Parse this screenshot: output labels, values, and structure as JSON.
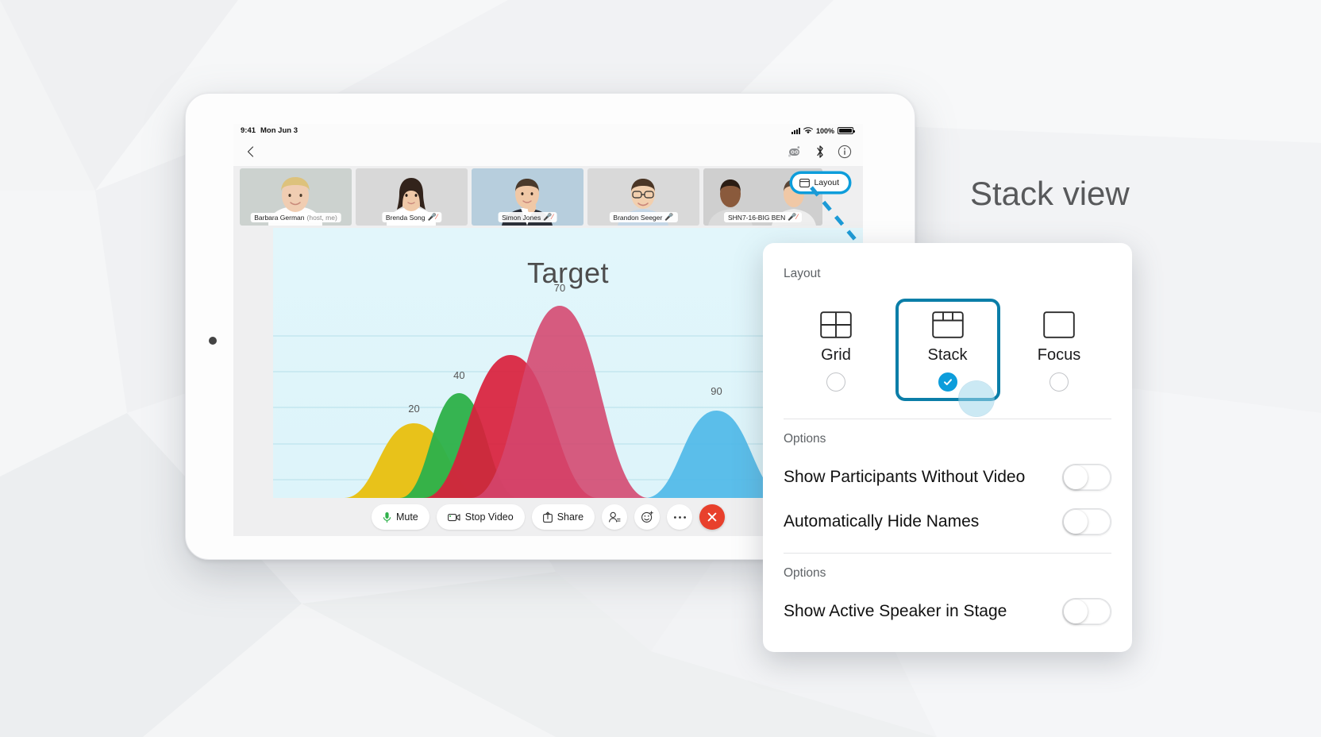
{
  "caption": "Stack view",
  "tablet": {
    "status_bar": {
      "time": "9:41",
      "date": "Mon Jun 3",
      "battery": "100%"
    },
    "nav": {
      "back_icon": "chevron-left-icon",
      "icons": [
        "bot-icon",
        "bluetooth-icon",
        "info-icon"
      ]
    },
    "layout_button": {
      "label": "Layout",
      "icon": "layout-icon"
    },
    "participants": [
      {
        "name": "Barbara German",
        "suffix": "(host, me)",
        "mic": "none",
        "skin": "#f0cdb2",
        "hair": "#d9c07a",
        "shirt": "#ffffff",
        "bg": "#ccd2cf"
      },
      {
        "name": "Brenda Song",
        "suffix": "",
        "mic": "muted",
        "skin": "#efc9a8",
        "hair": "#3b2a21",
        "shirt": "#ffffff",
        "bg": "#d8d8d8"
      },
      {
        "name": "Simon Jones",
        "suffix": "",
        "mic": "muted",
        "skin": "#f0c8a6",
        "hair": "#4a3a2c",
        "shirt": "#2b2f38",
        "bg": "#b7cedd"
      },
      {
        "name": "Brandon Seeger",
        "suffix": "",
        "mic": "on",
        "skin": "#f2cfae",
        "hair": "#4b3626",
        "shirt": "#c4d6e6",
        "bg": "#d9d9d9"
      },
      {
        "name": "SHN7-16-BIG BEN",
        "suffix": "",
        "mic": "muted",
        "skin": "#8a5a3c",
        "hair": "#2b1d14",
        "shirt": "#e8e8e8",
        "bg": "#cfcfcf"
      }
    ],
    "toolbar": [
      {
        "label": "Mute",
        "icon": "microphone-icon",
        "kind": "pill"
      },
      {
        "label": "Stop Video",
        "icon": "camera-icon",
        "kind": "pill"
      },
      {
        "label": "Share",
        "icon": "share-icon",
        "kind": "pill"
      },
      {
        "label": "",
        "icon": "participants-icon",
        "kind": "round"
      },
      {
        "label": "",
        "icon": "reactions-icon",
        "kind": "round"
      },
      {
        "label": "",
        "icon": "more-icon",
        "kind": "round"
      },
      {
        "label": "",
        "icon": "end-call-icon",
        "kind": "end"
      }
    ]
  },
  "popover": {
    "heading": "Layout",
    "modes": [
      {
        "label": "Grid",
        "icon": "grid-layout-icon",
        "selected": false
      },
      {
        "label": "Stack",
        "icon": "stack-layout-icon",
        "selected": true
      },
      {
        "label": "Focus",
        "icon": "focus-layout-icon",
        "selected": false
      }
    ],
    "sections": [
      {
        "label": "Options",
        "options": [
          {
            "label": "Show Participants Without Video",
            "on": false
          },
          {
            "label": "Automatically Hide Names",
            "on": false
          }
        ]
      },
      {
        "label": "Options",
        "options": [
          {
            "label": "Show Active Speaker in Stage",
            "on": false
          }
        ]
      }
    ]
  },
  "colors": {
    "accent": "#0d9ddb",
    "accent_dark": "#0b7ea8",
    "end_call": "#e8402c",
    "mic_on": "#2fb14a",
    "mic_muted": "#e8503a"
  },
  "chart_data": {
    "type": "area",
    "title": "Target",
    "xlabel": "",
    "ylabel": "",
    "grid": true,
    "legend": "none",
    "ylim": [
      0,
      100
    ],
    "annotations": [
      "20",
      "40",
      "70",
      "90"
    ],
    "series": [
      {
        "name": "yellow",
        "color": "#e8c21a",
        "peak_label": "20",
        "peak_value": 20,
        "center_pct": 24,
        "width_pct": 20,
        "height_pct": 28
      },
      {
        "name": "green",
        "color": "#2fb14a",
        "peak_label": "40",
        "peak_value": 40,
        "center_pct": 37,
        "width_pct": 15,
        "height_pct": 44
      },
      {
        "name": "red",
        "color": "#d91f3c",
        "peak_label": "",
        "peak_value": 62,
        "center_pct": 50,
        "width_pct": 20,
        "height_pct": 62
      },
      {
        "name": "pink",
        "color": "#d4466d",
        "peak_label": "70",
        "peak_value": 70,
        "center_pct": 55,
        "width_pct": 22,
        "height_pct": 76
      },
      {
        "name": "blue",
        "color": "#4fb9e8",
        "peak_label": "90",
        "peak_value": 90,
        "center_pct": 82,
        "width_pct": 20,
        "height_pct": 30
      }
    ]
  }
}
